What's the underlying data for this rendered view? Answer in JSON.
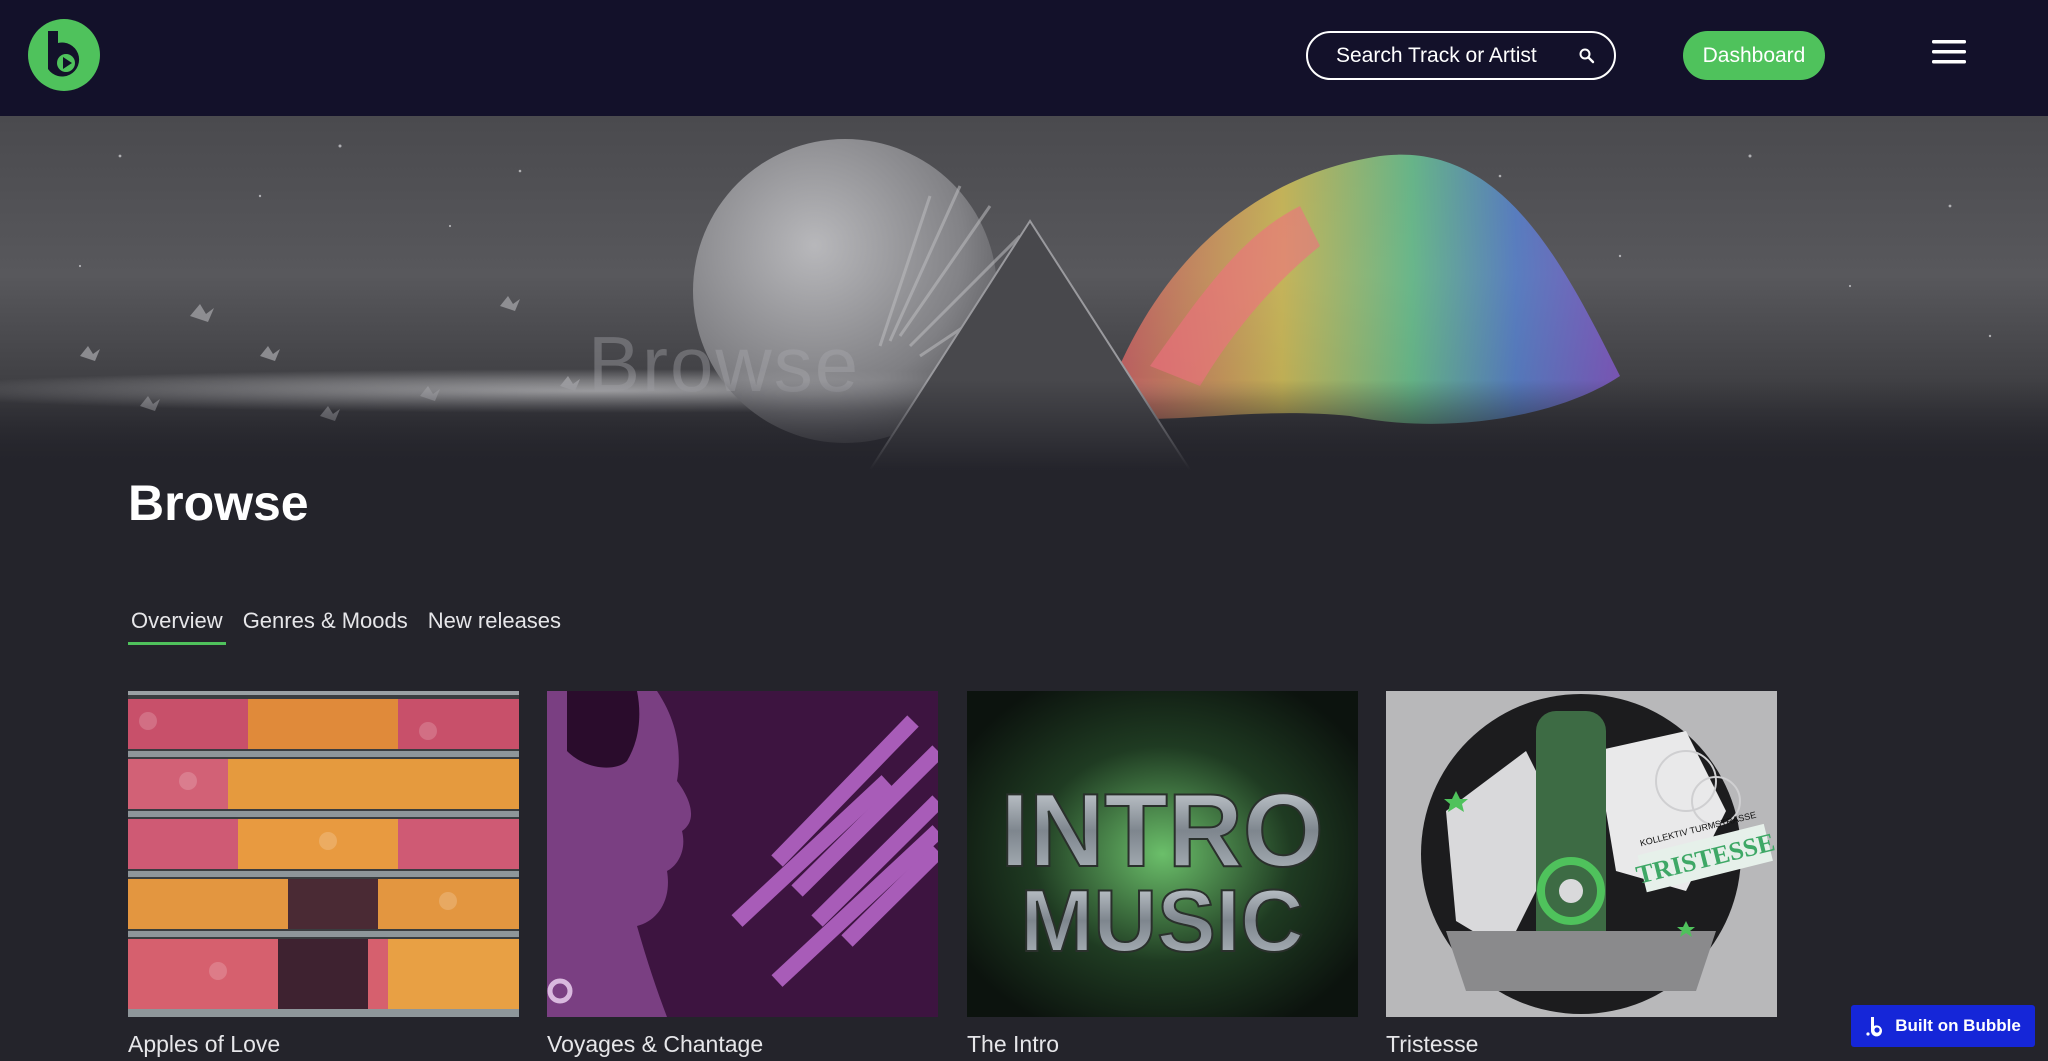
{
  "header": {
    "search_placeholder": "Search Track or Artist",
    "dashboard_label": "Dashboard",
    "logo_icon": "bubble-play-logo",
    "menu_icon": "hamburger-menu-icon"
  },
  "hero": {
    "watermark": "Browse"
  },
  "page": {
    "title": "Browse"
  },
  "tabs": [
    {
      "label": "Overview",
      "active": true
    },
    {
      "label": "Genres & Moods",
      "active": false
    },
    {
      "label": "New releases",
      "active": false
    }
  ],
  "cards": [
    {
      "title": "Apples of Love"
    },
    {
      "title": "Voyages & Chantage"
    },
    {
      "title": "The Intro",
      "art_lines": [
        "INTRO",
        "MUSIC"
      ]
    },
    {
      "title": "Tristesse",
      "art_text": "TRISTESSE",
      "art_small_text": "KOLLEKTIV TURMSTRASSE"
    }
  ],
  "badge": {
    "label": "Built on Bubble"
  },
  "colors": {
    "header_bg": "#13112a",
    "page_bg": "#24242b",
    "accent_green": "#4fc25c",
    "badge_blue": "#1526d8"
  }
}
